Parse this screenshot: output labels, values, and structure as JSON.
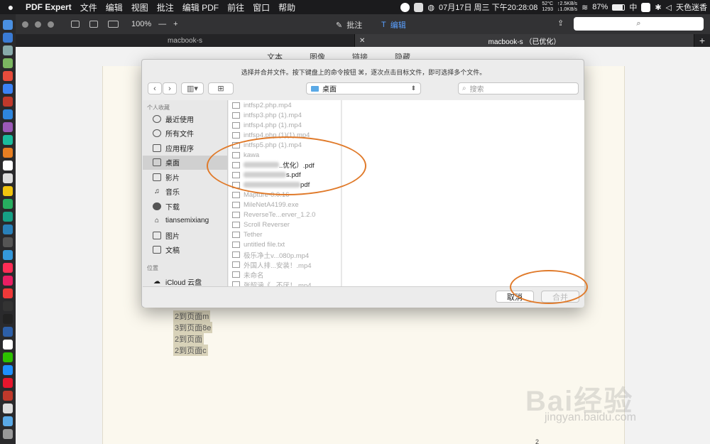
{
  "menubar": {
    "app": "PDF Expert",
    "items": [
      "文件",
      "编辑",
      "视图",
      "批注",
      "编辑 PDF",
      "前往",
      "窗口",
      "帮助"
    ],
    "clock": "07月17日 周三 下午20:28:08",
    "temp": "52°C",
    "cpu": "1293",
    "net_up": "↑2.5KB/s",
    "net_down": "↓1.0KB/s",
    "battery": "87%",
    "input_method": "中",
    "user": "天色迷香"
  },
  "toolbar": {
    "zoom": "100%",
    "zoom_minus": "—",
    "zoom_plus": "+",
    "annotate": "批注",
    "edit": "编辑"
  },
  "tabs": [
    "macbook-s",
    "macbook-s （已优化）"
  ],
  "subtools": [
    "文本",
    "图像",
    "链接",
    "隐藏"
  ],
  "dialog": {
    "title": "选择并合并文件。按下键盘上的命令按钮 ⌘，逐次点击目标文件，即可选择多个文件。",
    "location": "桌面",
    "search_placeholder": "搜索",
    "favorites_header": "个人收藏",
    "location_header": "位置",
    "sidebar": [
      {
        "label": "最近使用",
        "icon": "recent-icon"
      },
      {
        "label": "所有文件",
        "icon": "gear-icon"
      },
      {
        "label": "应用程序",
        "icon": "apps-icon"
      },
      {
        "label": "桌面",
        "icon": "desktop-icon",
        "selected": true
      },
      {
        "label": "影片",
        "icon": "film-icon"
      },
      {
        "label": "音乐",
        "icon": "music-icon"
      },
      {
        "label": "下载",
        "icon": "download-icon"
      },
      {
        "label": "tiansemixiang",
        "icon": "home-icon"
      },
      {
        "label": "图片",
        "icon": "camera-icon"
      },
      {
        "label": "文稿",
        "icon": "doc-icon"
      }
    ],
    "icloud": "iCloud 云盘",
    "files": [
      {
        "name": "intfsp2.php.mp4",
        "enabled": false
      },
      {
        "name": "intfsp3.php (1).mp4",
        "enabled": false
      },
      {
        "name": "intfsp4.php (1).mp4",
        "enabled": false
      },
      {
        "name": "intfsp4.php (1)(1).mp4",
        "enabled": false
      },
      {
        "name": "intfsp5.php (1).mp4",
        "enabled": false
      },
      {
        "name": "kawa",
        "enabled": false
      },
      {
        "name": "..优化）.pdf",
        "enabled": true,
        "blur": 50
      },
      {
        "name": "s.pdf",
        "enabled": true,
        "blur": 60
      },
      {
        "name": "pdf",
        "enabled": true,
        "blur": 80
      },
      {
        "name": "Mapture-0.0.16",
        "enabled": false
      },
      {
        "name": "MileNetA4199.exe",
        "enabled": false
      },
      {
        "name": "ReverseTe...erver_1.2.0",
        "enabled": false
      },
      {
        "name": "Scroll Reverser",
        "enabled": false
      },
      {
        "name": "Tether",
        "enabled": false
      },
      {
        "name": "untitled file.txt",
        "enabled": false
      },
      {
        "name": "极乐净土v...080p.mp4",
        "enabled": false
      },
      {
        "name": "外国人排...安装！.mp4",
        "enabled": false
      },
      {
        "name": "未命名",
        "enabled": false
      },
      {
        "name": "张韶涵《...不厌！.mp4",
        "enabled": false
      }
    ],
    "cancel": "取消",
    "merge": "合并"
  },
  "page_lines": [
    "2到页面m",
    "3到页面8e",
    "2到页面",
    "2到页面c"
  ],
  "page_number": "2",
  "watermark": {
    "brand": "Bai经验",
    "url": "jingyan.baidu.com"
  }
}
